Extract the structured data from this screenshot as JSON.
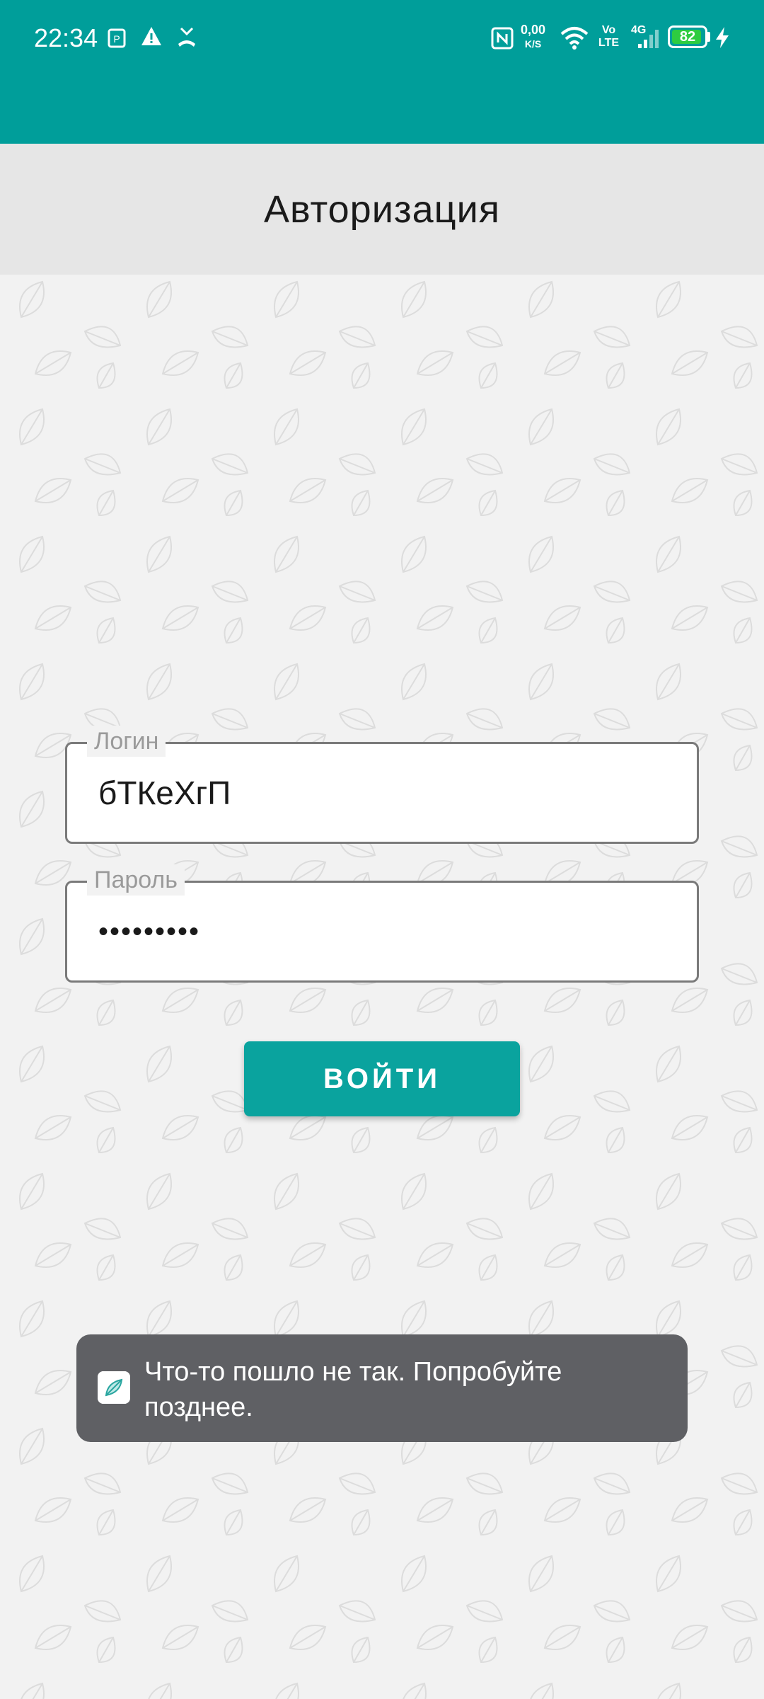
{
  "status_bar": {
    "time": "22:34",
    "net_speed": "0,00",
    "net_speed_unit": "K/S",
    "volte_top": "Vo",
    "volte_bottom": "LTE",
    "network": "4G",
    "battery": "82",
    "icons": [
      "nfc-icon",
      "warning-icon",
      "missed-call-icon",
      "wifi-icon",
      "signal-icon",
      "charging-icon"
    ]
  },
  "appbar": {
    "title": "Авторизация"
  },
  "form": {
    "login": {
      "label": "Логин",
      "value": "бТКеХгП"
    },
    "password": {
      "label": "Пароль",
      "value": "•••••••••"
    },
    "submit_label": "ВОЙТИ"
  },
  "toast": {
    "message": "Что-то пошло не так. Попробуйте позднее."
  },
  "colors": {
    "status_bar": "#009e9a",
    "appbar": "#e6e6e6",
    "button": "#0aa39e",
    "toast": "#5f6064",
    "background": "#f2f2f2"
  }
}
